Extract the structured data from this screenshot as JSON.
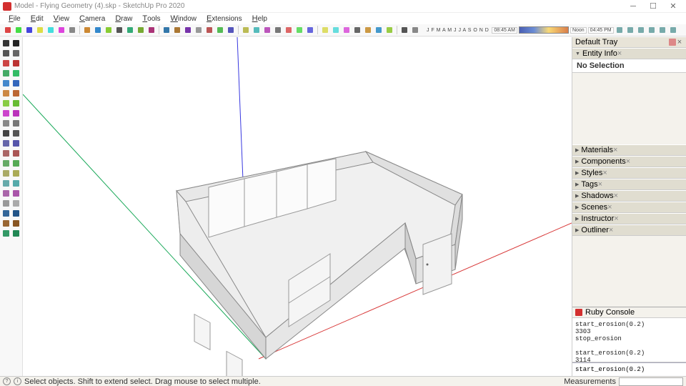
{
  "title": "Model - Flying Geometry (4).skp - SketchUp Pro 2020",
  "menu": [
    "File",
    "Edit",
    "View",
    "Camera",
    "Draw",
    "Tools",
    "Window",
    "Extensions",
    "Help"
  ],
  "months": "J F M A M J J A S O N D",
  "time_left": "08:45 AM",
  "time_mid": "Noon",
  "time_right": "04:45 PM",
  "tray": {
    "title": "Default Tray",
    "entity_info": "Entity Info",
    "no_selection": "No Selection",
    "panels": [
      "Materials",
      "Components",
      "Styles",
      "Tags",
      "Shadows",
      "Scenes",
      "Instructor",
      "Outliner"
    ]
  },
  "ruby": {
    "title": "Ruby Console",
    "output": "start_erosion(0.2)\n3303\nstop_erosion\n\nstart_erosion(0.2)\n3114",
    "input": "start_erosion(0.2)"
  },
  "status": {
    "hint": "Select objects. Shift to extend select. Drag mouse to select multiple.",
    "meas_label": "Measurements"
  },
  "tool_colors_a": [
    "#333",
    "#555",
    "#c44",
    "#4a6",
    "#48c",
    "#c84",
    "#8c4",
    "#c4c",
    "#888",
    "#444",
    "#66a",
    "#a66",
    "#6a6",
    "#aa6",
    "#6aa",
    "#a6a",
    "#999",
    "#369",
    "#963",
    "#396"
  ],
  "tool_colors_b": [
    "#222",
    "#666",
    "#b33",
    "#3b6",
    "#36b",
    "#b63",
    "#6b3",
    "#b3b",
    "#777",
    "#555",
    "#55a",
    "#a55",
    "#5a5",
    "#aa5",
    "#5aa",
    "#a5a",
    "#aaa",
    "#258",
    "#852",
    "#285"
  ],
  "row1_colors": [
    "#d44",
    "#4d4",
    "#44d",
    "#dd4",
    "#4dd",
    "#d4d",
    "#888",
    "#c83",
    "#38c",
    "#8c3",
    "#555",
    "#3a7",
    "#7a3",
    "#a37",
    "#37a",
    "#a73",
    "#73a",
    "#999",
    "#b55",
    "#5b5",
    "#55b",
    "#bb5",
    "#5bb",
    "#b5b",
    "#777",
    "#d66",
    "#6d6",
    "#66d",
    "#dd6",
    "#6dd",
    "#d6d",
    "#666",
    "#c94",
    "#49c",
    "#9c4",
    "#555",
    "#888"
  ],
  "row2_colors": [
    "#c55",
    "#5c5",
    "#55c",
    "#cc5",
    "#5cc",
    "#c5c",
    "#777",
    "#b74",
    "#47b",
    "#7b4",
    "#666",
    "#296",
    "#692",
    "#926",
    "#269",
    "#962",
    "#629",
    "#888",
    "#a44",
    "#4a4",
    "#44a",
    "#aa4",
    "#4aa",
    "#a4a",
    "#666",
    "#c77",
    "#7c7",
    "#77c",
    "#cc7",
    "#7cc",
    "#c7c",
    "#555"
  ]
}
